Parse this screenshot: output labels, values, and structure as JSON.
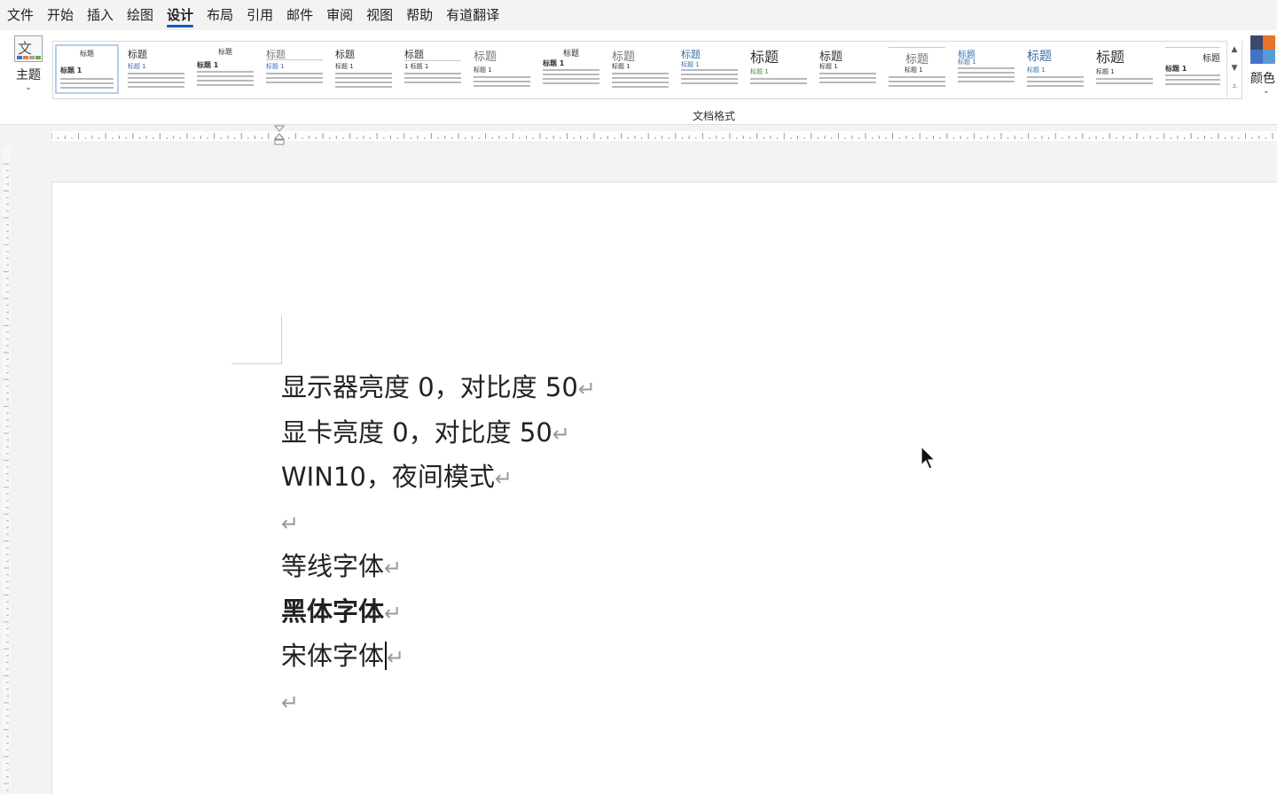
{
  "menu": {
    "items": [
      "文件",
      "开始",
      "插入",
      "绘图",
      "设计",
      "布局",
      "引用",
      "邮件",
      "审阅",
      "视图",
      "帮助",
      "有道翻译"
    ],
    "active": "设计"
  },
  "ribbon": {
    "theme_label": "主题",
    "color_label": "颜色",
    "group_label": "文档格式",
    "styles": [
      {
        "title": "标题",
        "h1": "标题 1"
      },
      {
        "title": "标题",
        "h1": "标题 1"
      },
      {
        "title": "标题",
        "h1": "标题 1"
      },
      {
        "title": "标题",
        "h1": "标题 1"
      },
      {
        "title": "标题",
        "h1": "标题 1"
      },
      {
        "title": "标题",
        "h1": "1  标题 1"
      },
      {
        "title": "标题",
        "h1": "标题 1"
      },
      {
        "title": "标题",
        "h1": "标题 1"
      },
      {
        "title": "标题",
        "h1": "标题 1"
      },
      {
        "title": "标题",
        "h1": "标题 1"
      },
      {
        "title": "标题",
        "h1": "标题 1"
      },
      {
        "title": "标题",
        "h1": "标题 1"
      },
      {
        "title": "标题",
        "h1": "标题 1"
      },
      {
        "title": "标题",
        "h1": "标题 1"
      },
      {
        "title": "标题",
        "h1": "标题 1"
      },
      {
        "title": "标题",
        "h1": "标题 1"
      },
      {
        "title": "标题",
        "h1": "标题 1"
      }
    ],
    "theme_colors": [
      "#3b4a6b",
      "#e8722a",
      "#4472c4",
      "#5b9bd5"
    ]
  },
  "document": {
    "paragraphs": [
      {
        "text": "显示器亮度 0，对比度 50",
        "style": "normal"
      },
      {
        "text": "显卡亮度 0，对比度 50",
        "style": "normal"
      },
      {
        "text": "WIN10，夜间模式",
        "style": "normal"
      },
      {
        "text": "",
        "style": "normal"
      },
      {
        "text": "等线字体",
        "style": "normal"
      },
      {
        "text": "黑体字体",
        "style": "bold"
      },
      {
        "text": "宋体字体",
        "style": "serif",
        "caret": true
      },
      {
        "text": "",
        "style": "normal"
      }
    ],
    "paragraph_mark": "↵"
  },
  "colors": {
    "accent": "#185abd"
  }
}
